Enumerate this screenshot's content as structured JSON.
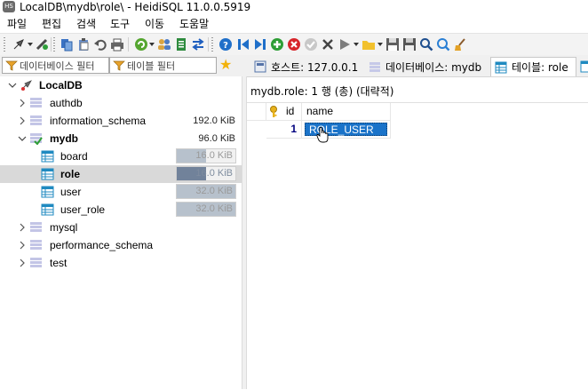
{
  "window": {
    "title": "LocalDB\\mydb\\role\\ - HeidiSQL 11.0.0.5919",
    "app_icon_text": "HS"
  },
  "menu": [
    "파일",
    "편집",
    "검색",
    "도구",
    "이동",
    "도움말"
  ],
  "toolbar": {
    "icons": [
      "connect-icon",
      "disconnect-icon",
      "copy-icon",
      "paste-icon",
      "undo-icon",
      "print-icon",
      "refresh-icon",
      "user-manager-icon",
      "export-icon",
      "transfer-icon",
      "help-icon",
      "first-record-icon",
      "last-record-icon",
      "add-record-icon",
      "delete-record-icon",
      "post-record-icon",
      "cancel-record-icon",
      "execute-icon",
      "open-folder-icon",
      "save-icon",
      "save-as-icon",
      "find-icon",
      "replace-icon",
      "clear-icon"
    ]
  },
  "filters": {
    "database": "데이터베이스 필터",
    "table": "테이블 필터"
  },
  "tabs": [
    {
      "label": "호스트: 127.0.0.1"
    },
    {
      "label": "데이터베이스: mydb"
    },
    {
      "label": "테이블: role",
      "active": true
    }
  ],
  "tree": {
    "root": "LocalDB",
    "nodes": [
      {
        "label": "authdb",
        "size": ""
      },
      {
        "label": "information_schema",
        "size": "192.0 KiB"
      },
      {
        "label": "mydb",
        "size": "96.0 KiB",
        "expanded": true
      },
      {
        "label": "board",
        "size": "16.0 KiB",
        "fill": 0.5
      },
      {
        "label": "role",
        "size": "16.0 KiB",
        "fill": 0.5,
        "selected": true
      },
      {
        "label": "user",
        "size": "32.0 KiB",
        "fill": 1.0
      },
      {
        "label": "user_role",
        "size": "32.0 KiB",
        "fill": 1.0
      },
      {
        "label": "mysql",
        "size": ""
      },
      {
        "label": "performance_schema",
        "size": ""
      },
      {
        "label": "test",
        "size": ""
      }
    ]
  },
  "grid": {
    "caption": "mydb.role: 1 행 (총) (대략적)",
    "columns": [
      "id",
      "name"
    ],
    "rows": [
      {
        "id": "1",
        "name": "ROLE_USER"
      }
    ]
  },
  "colors": {
    "selection": "#1a73c9",
    "tree_selected": "#d9d9d9",
    "size_bar": "#b7c1cc"
  }
}
